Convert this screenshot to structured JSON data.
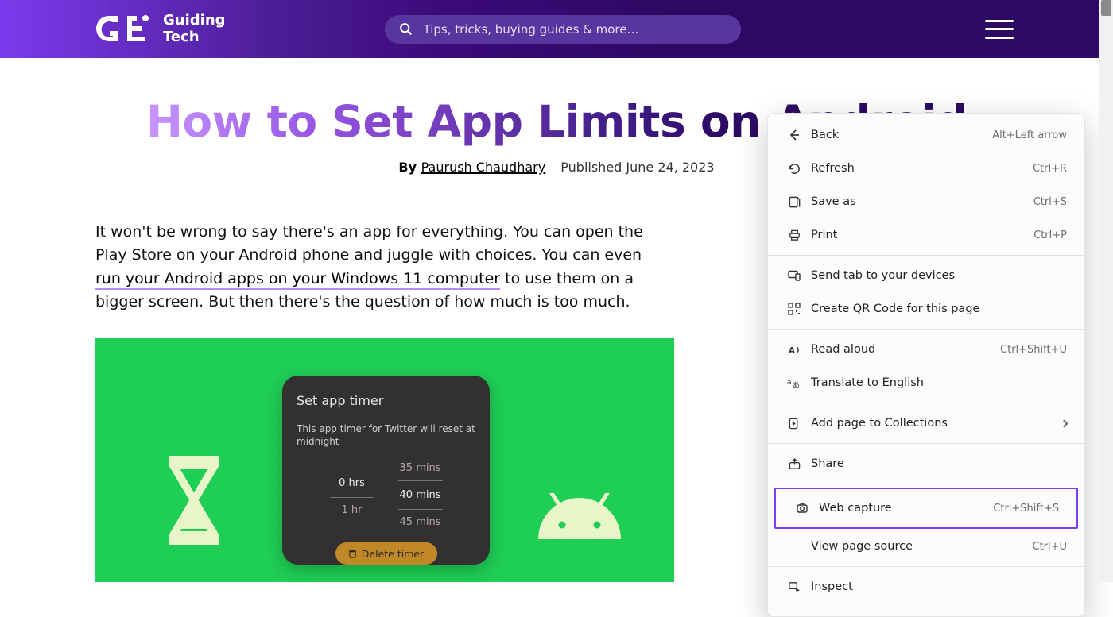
{
  "header": {
    "logoText": "Guiding\nTech",
    "searchPlaceholder": "Tips, tricks, buying guides & more…"
  },
  "article": {
    "title": "How to Set App Limits on Android",
    "bylinePrefix": "By ",
    "author": "Paurush Chaudhary",
    "published": "Published June 24, 2023",
    "p1a": "It won't be wrong to say there's an app for everything. You can open the Play Store on your Android phone and juggle with choices. You can even ",
    "linkText": "run your Android apps on your Windows 11 computer",
    "p1b": " to use them on a bigger screen. But then there's the question of how much is too much."
  },
  "hero": {
    "dialogTitle": "Set app timer",
    "dialogBody": "This app timer for Twitter will reset at midnight",
    "pickerHoursAbove": "",
    "pickerHoursSel": "0 hrs",
    "pickerHoursBelow": "1 hr",
    "pickerMinutesAbove": "35 mins",
    "pickerMinutesSel": "40 mins",
    "pickerMinutesBelow": "45 mins",
    "deleteLabel": "Delete timer"
  },
  "ctx": {
    "items": [
      {
        "label": "Back",
        "shortcut": "Alt+Left arrow"
      },
      {
        "label": "Refresh",
        "shortcut": "Ctrl+R"
      },
      {
        "label": "Save as",
        "shortcut": "Ctrl+S"
      },
      {
        "label": "Print",
        "shortcut": "Ctrl+P"
      },
      {
        "label": "Send tab to your devices",
        "shortcut": ""
      },
      {
        "label": "Create QR Code for this page",
        "shortcut": ""
      },
      {
        "label": "Read aloud",
        "shortcut": "Ctrl+Shift+U"
      },
      {
        "label": "Translate to English",
        "shortcut": ""
      },
      {
        "label": "Add page to Collections",
        "shortcut": ""
      },
      {
        "label": "Share",
        "shortcut": ""
      },
      {
        "label": "Web capture",
        "shortcut": "Ctrl+Shift+S"
      },
      {
        "label": "View page source",
        "shortcut": "Ctrl+U"
      },
      {
        "label": "Inspect",
        "shortcut": ""
      }
    ]
  }
}
